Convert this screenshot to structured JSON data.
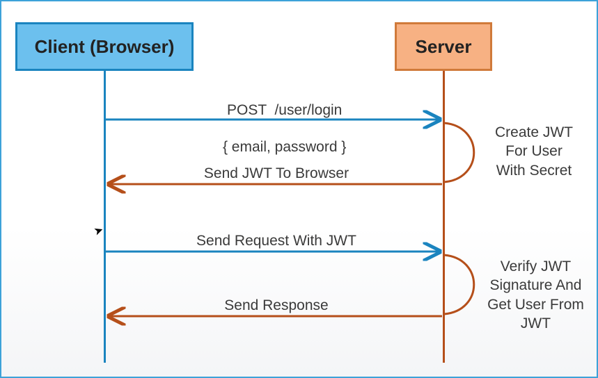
{
  "nodes": {
    "client": {
      "label": "Client (Browser)",
      "fill": "#6cc0ee",
      "stroke": "#1a84bf"
    },
    "server": {
      "label": "Server",
      "fill": "#f7b183",
      "stroke": "#d07a3a"
    }
  },
  "lifelines": {
    "client_color": "#1a84bf",
    "server_color": "#b54f1a"
  },
  "messages": {
    "m1_line1": "POST  /user/login",
    "m1_line2": "{ email, password }",
    "m2": "Send JWT To Browser",
    "m3": "Send Request With JWT",
    "m4": "Send Response"
  },
  "loops": {
    "l1": "Create JWT\nFor User\nWith Secret",
    "l2": "Verify JWT\nSignature And\nGet User From\nJWT"
  },
  "colors": {
    "req": "#1a84bf",
    "res": "#b54f1a"
  }
}
